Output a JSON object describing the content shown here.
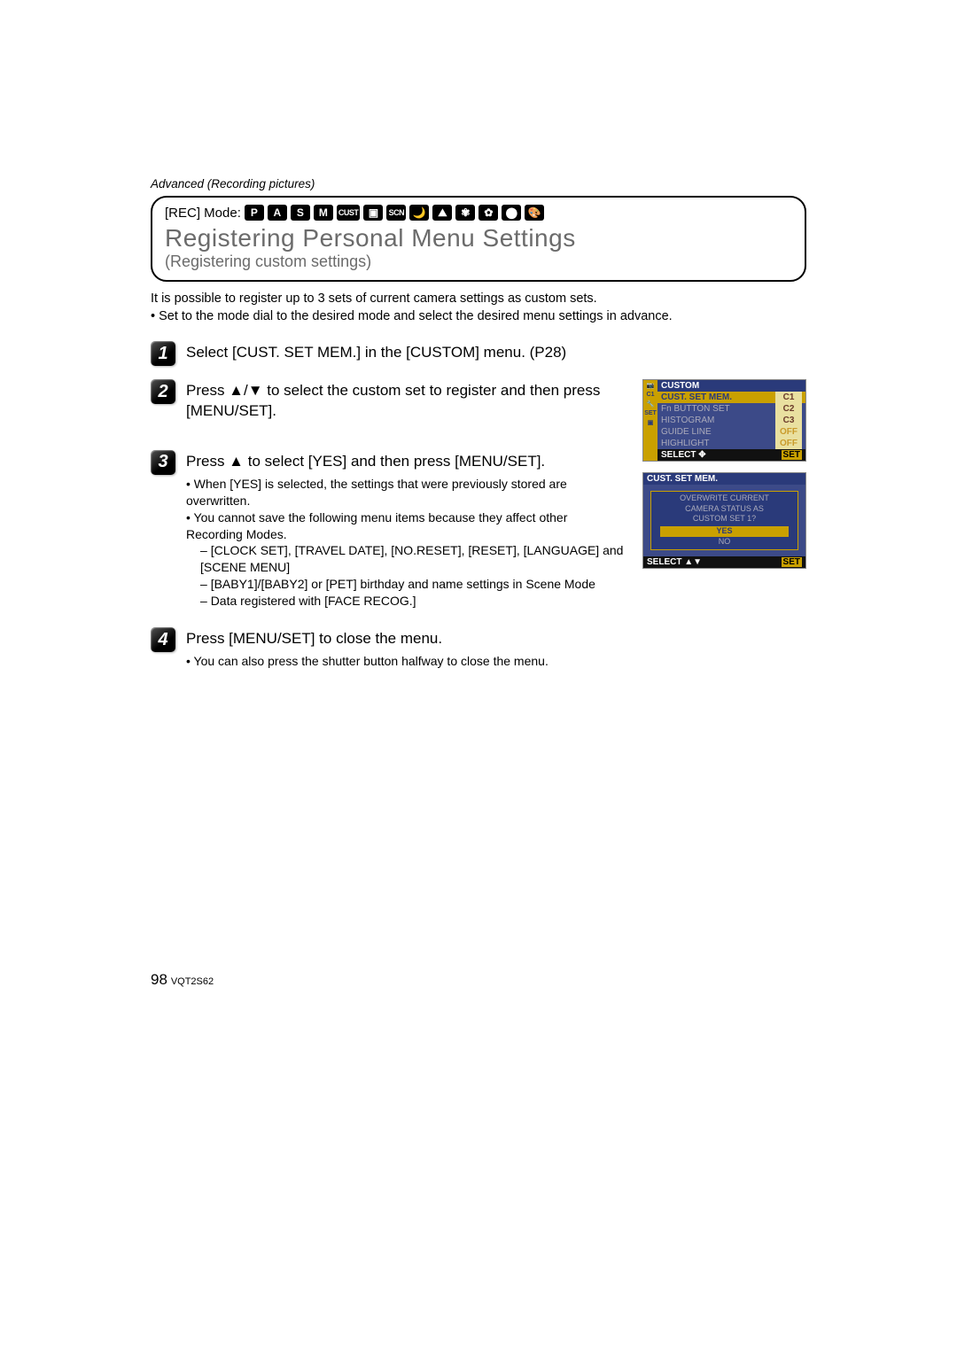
{
  "section_header": "Advanced (Recording pictures)",
  "rec_mode_label": "[REC] Mode:",
  "mode_badges": [
    "P",
    "A",
    "S",
    "M",
    "CUST",
    "▣",
    "SCN",
    "🌙",
    "⛰",
    "✾",
    "✿",
    "⬤",
    "🎨"
  ],
  "title": "Registering Personal Menu Settings",
  "subtitle": "(Registering custom settings)",
  "intro_line1": "It is possible to register up to 3 sets of current camera settings as custom sets.",
  "intro_line2": "Set to the mode dial to the desired mode and select the desired menu settings in advance.",
  "steps": {
    "s1": {
      "num": "1",
      "title": "Select [CUST. SET MEM.] in the [CUSTOM] menu. (P28)"
    },
    "s2": {
      "num": "2",
      "title": "Press ▲/▼ to select the custom set to register and then press [MENU/SET]."
    },
    "s3": {
      "num": "3",
      "title": "Press ▲ to select [YES] and then press [MENU/SET].",
      "note1": "When [YES] is selected, the settings that were previously stored are overwritten.",
      "note2": "You cannot save the following menu items because they affect other Recording Modes.",
      "sub1": "[CLOCK SET], [TRAVEL DATE], [NO.RESET], [RESET], [LANGUAGE] and [SCENE MENU]",
      "sub2": "[BABY1]/[BABY2] or [PET] birthday and name settings in Scene Mode",
      "sub3": "Data registered with [FACE RECOG.]"
    },
    "s4": {
      "num": "4",
      "title": "Press [MENU/SET] to close the menu.",
      "note1": "You can also press the shutter button halfway to close the menu."
    }
  },
  "screenshots": {
    "ss1": {
      "header": "CUSTOM",
      "sidebar": [
        "📷",
        "C1",
        "🔧",
        "SET",
        "▣"
      ],
      "rows": [
        {
          "label": "CUST. SET MEM.",
          "val": "C1",
          "sel": true
        },
        {
          "label": "Fn BUTTON SET",
          "val": "C2"
        },
        {
          "label": "HISTOGRAM",
          "val": "C3"
        },
        {
          "label": "GUIDE LINE",
          "val": "OFF"
        },
        {
          "label": "HIGHLIGHT",
          "val": "OFF"
        }
      ],
      "footer_select": "SELECT ✥",
      "footer_set": "SET"
    },
    "ss2": {
      "header": "CUST. SET MEM.",
      "dialog_l1": "OVERWRITE CURRENT",
      "dialog_l2": "CAMERA STATUS AS",
      "dialog_l3": "CUSTOM SET 1?",
      "yes": "YES",
      "no": "NO",
      "footer_select": "SELECT ▲▼",
      "footer_set": "SET"
    }
  },
  "page_number": "98",
  "doc_id": "VQT2S62"
}
